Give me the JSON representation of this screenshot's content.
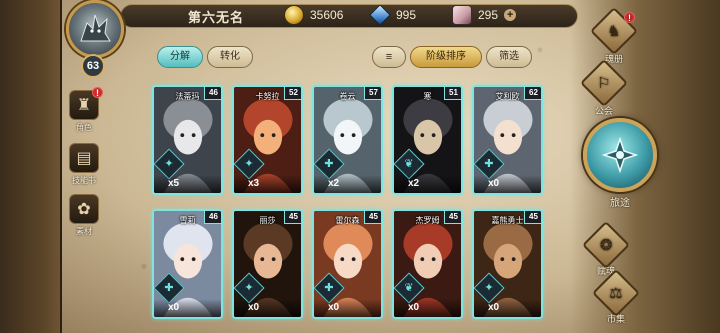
{
  "player": {
    "name": "第六无名",
    "level": "63"
  },
  "resources": {
    "gold": {
      "icon": "gold-coin-icon",
      "value": "35606"
    },
    "crystal": {
      "icon": "blue-crystal-icon",
      "value": "995"
    },
    "stone": {
      "icon": "pink-stone-icon",
      "value": "295",
      "add_label": "+"
    }
  },
  "left_nav": [
    {
      "label": "角色",
      "icon": "character-helmet-icon",
      "alert": "!"
    },
    {
      "label": "技能书",
      "icon": "skill-book-icon"
    },
    {
      "label": "素材",
      "icon": "material-fox-icon"
    }
  ],
  "tabs": {
    "decompose": "分解",
    "transform": "转化"
  },
  "sort": {
    "list_icon": "sort-list-icon",
    "order_label": "阶级排序",
    "filter_label": "筛选"
  },
  "heroes": [
    {
      "name": "法蒂玛",
      "level": "46",
      "count": "x5",
      "portrait": "gray-wolf",
      "class_icon": "flame-icon"
    },
    {
      "name": "卡努拉",
      "level": "52",
      "count": "x3",
      "portrait": "red-boar",
      "class_icon": "flame-icon"
    },
    {
      "name": "卷云",
      "level": "57",
      "count": "x2",
      "portrait": "white-wolf",
      "class_icon": "shield-icon"
    },
    {
      "name": "寒",
      "level": "51",
      "count": "x2",
      "portrait": "dark-warrior",
      "class_icon": "wing-icon"
    },
    {
      "name": "艾利欧",
      "level": "62",
      "count": "x0",
      "portrait": "silver-hair-boy",
      "class_icon": "shield-icon"
    },
    {
      "name": "雪莉",
      "level": "46",
      "count": "x0",
      "portrait": "white-hair-girl",
      "class_icon": "shield-icon"
    },
    {
      "name": "丽莎",
      "level": "45",
      "count": "x0",
      "portrait": "gold-crown-girl",
      "class_icon": "flame-icon"
    },
    {
      "name": "雷尔森",
      "level": "45",
      "count": "x0",
      "portrait": "orange-hair-boy",
      "class_icon": "shield-icon"
    },
    {
      "name": "杰罗姆",
      "level": "45",
      "count": "x0",
      "portrait": "red-hood-boy",
      "class_icon": "wing-icon"
    },
    {
      "name": "嘉熊勇士",
      "level": "45",
      "count": "x0",
      "portrait": "brown-bear",
      "class_icon": "flame-icon"
    }
  ],
  "right_nav": {
    "handbook": {
      "label": "魂册",
      "alert": "!"
    },
    "guild": {
      "label": "公会"
    },
    "journey": {
      "label": "旅途"
    },
    "talent": {
      "label": "赋魂"
    },
    "market": {
      "label": "市集"
    }
  },
  "colors": {
    "card_border": "#7fe3e0",
    "accent_teal": "#55bdbd",
    "gold_frame": "#c69a4e"
  }
}
